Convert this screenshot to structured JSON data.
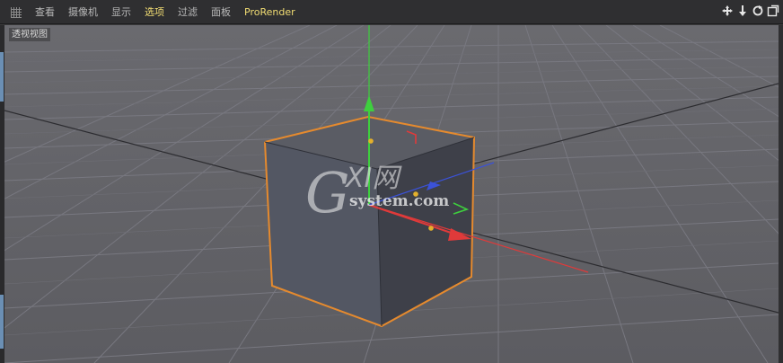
{
  "menubar": {
    "items": [
      {
        "label": "查看",
        "active": false
      },
      {
        "label": "摄像机",
        "active": false
      },
      {
        "label": "显示",
        "active": false
      },
      {
        "label": "选项",
        "active": true
      },
      {
        "label": "过滤",
        "active": false
      },
      {
        "label": "面板",
        "active": false
      },
      {
        "label": "ProRender",
        "active": false
      }
    ],
    "right_icons": [
      "move-view-icon",
      "zoom-view-icon",
      "rotate-view-icon",
      "maximize-view-icon"
    ]
  },
  "viewport": {
    "label": "透视视图",
    "object": "cube",
    "axes": {
      "x": "#e03a3a",
      "y": "#3ecf3e",
      "z": "#3b52d8"
    },
    "selection_color": "#e58a2e"
  },
  "watermark": {
    "logo": "GXI网",
    "text": "system.com"
  },
  "colors": {
    "menubar_bg": "#2f2f31",
    "viewport_bg": "#5f5f64",
    "active_menu": "#f2dd73"
  }
}
